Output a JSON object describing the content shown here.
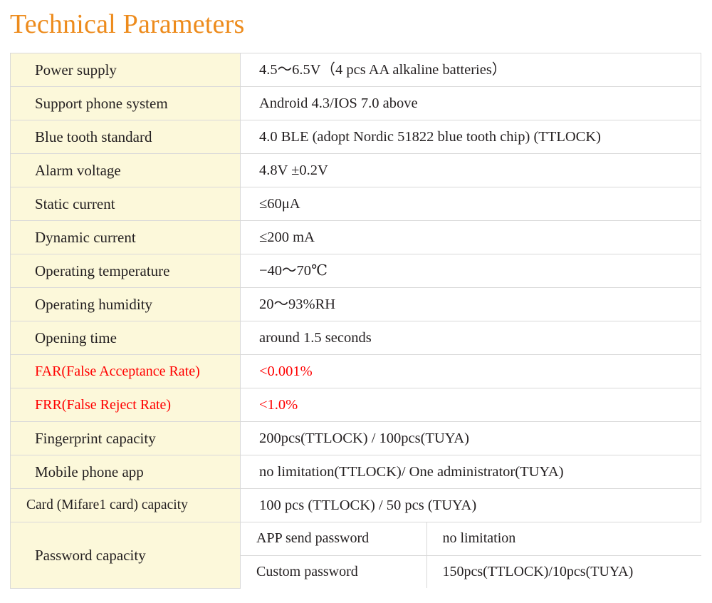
{
  "title": "Technical Parameters",
  "colors": {
    "title": "#ED8B1C",
    "label_background": "#FCF8DA",
    "border": "#D9D9D9",
    "text": "#231F20",
    "highlight": "#FF0000"
  },
  "table": {
    "rows": [
      {
        "label": "Power supply",
        "value": "4.5～6.5V（4 pcs AA alkaline batteries）"
      },
      {
        "label": "Support phone system",
        "value": "Android 4.3/IOS 7.0 above"
      },
      {
        "label": "Blue tooth standard",
        "value": "4.0 BLE (adopt Nordic 51822 blue tooth chip) (TTLOCK)"
      },
      {
        "label": "Alarm voltage",
        "value": "4.8V ±0.2V"
      },
      {
        "label": "Static current",
        "value": "≤60μA"
      },
      {
        "label": "Dynamic current",
        "value": "≤200 mA"
      },
      {
        "label": "Operating temperature",
        "value": "−40～70℃"
      },
      {
        "label": "Operating humidity",
        "value": "20～93%RH"
      },
      {
        "label": "Opening time",
        "value": "around 1.5 seconds"
      },
      {
        "label": "FAR(False Acceptance Rate)",
        "value": "<0.001%",
        "highlight": true
      },
      {
        "label": "FRR(False Reject Rate)",
        "value": "<1.0%",
        "highlight": true
      },
      {
        "label": "Fingerprint capacity",
        "value": "200pcs(TTLOCK) / 100pcs(TUYA)"
      },
      {
        "label": "Mobile phone app",
        "value": "no limitation(TTLOCK)/ One administrator(TUYA)"
      },
      {
        "label": "Card (Mifare1 card) capacity",
        "value": "100 pcs (TTLOCK) / 50 pcs (TUYA)"
      }
    ],
    "password_row": {
      "label": "Password capacity",
      "sub_rows": [
        {
          "key": "APP send password",
          "value": "no limitation"
        },
        {
          "key": "Custom password",
          "value": "150pcs(TTLOCK)/10pcs(TUYA)"
        }
      ]
    }
  }
}
